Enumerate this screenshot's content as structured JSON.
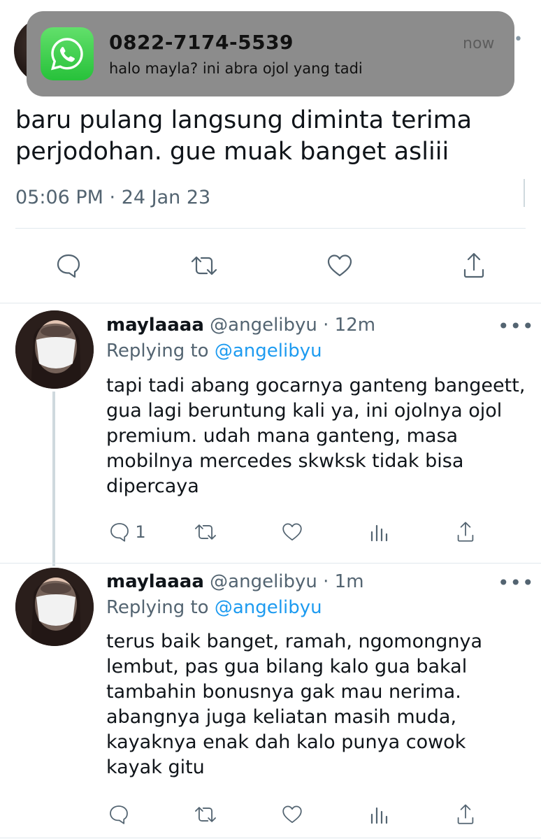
{
  "notification": {
    "app_icon": "whatsapp-icon",
    "title": "0822-7174-5539",
    "time": "now",
    "body": "halo mayla? ini abra ojol yang tadi"
  },
  "main_tweet": {
    "text": "baru pulang langsung diminta terima perjodohan. gue muak banget asliii",
    "timestamp": "05:06 PM · 24 Jan 23",
    "actions": [
      "reply-icon",
      "retweet-icon",
      "like-icon",
      "share-icon"
    ]
  },
  "replies": [
    {
      "name": "maylaaaa",
      "handle": "@angelibyu",
      "time": "· 12m",
      "replying_label": "Replying to",
      "replying_to": "@angelibyu",
      "text": "tapi tadi abang gocarnya ganteng bangeett, gua lagi beruntung kali ya, ini ojolnya ojol premium. udah mana ganteng, masa mobilnya mercedes skwksk tidak bisa dipercaya",
      "reply_count": "1",
      "more": "•••"
    },
    {
      "name": "maylaaaa",
      "handle": "@angelibyu",
      "time": "· 1m",
      "replying_label": "Replying to",
      "replying_to": "@angelibyu",
      "text": "terus baik banget, ramah, ngomongnya lembut, pas gua bilang kalo gua bakal tambahin bonusnya gak mau nerima. abangnya juga keliatan masih muda, kayaknya enak dah kalo punya cowok kayak gitu",
      "reply_count": "",
      "more": "•••"
    }
  ],
  "colors": {
    "accent": "#1d9bf0",
    "secondary_text": "#536471",
    "notification_bg": "#8c8c8c",
    "whatsapp_green": "#27c13a"
  }
}
